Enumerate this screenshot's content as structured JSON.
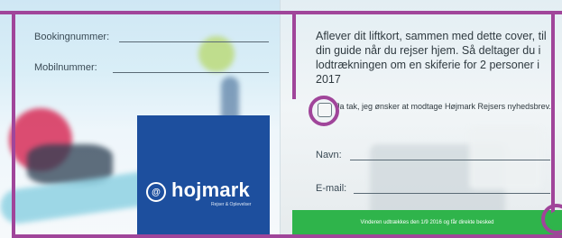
{
  "left_panel": {
    "fields": [
      {
        "label": "Bookingnummer:"
      },
      {
        "label": "Mobilnummer:"
      }
    ],
    "brand": {
      "logo_mark": "@",
      "name": "hojmark",
      "tagline": "Rejser & Oplevelser"
    }
  },
  "right_panel": {
    "intro": "Aflever dit liftkort, sammen med dette cover, til din guide når du rejser hjem. Så deltager du i lodtrækningen om en skiferie for 2 personer i 2017",
    "consent": "Ja tak, jeg ønsker at modtage Højmark Rejsers nyhedsbrev.",
    "fields": [
      {
        "label": "Navn:"
      },
      {
        "label": "E-mail:"
      }
    ],
    "footer_bar": "Vinderen udtrækkes den 1/9 2016 og får direkte besked"
  },
  "colors": {
    "brand_blue": "#1d4f9e",
    "banner_green": "#2fb44b",
    "highlight_purple": "#a0459a"
  }
}
